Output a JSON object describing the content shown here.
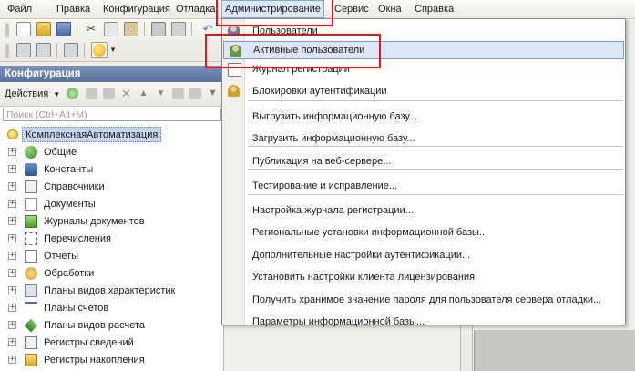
{
  "menubar": {
    "items": [
      {
        "label": "Файл"
      },
      {
        "label": "Правка"
      },
      {
        "label": "Конфигурация"
      },
      {
        "label": "Отладка"
      },
      {
        "label": "Администрирование"
      },
      {
        "label": "Сервис"
      },
      {
        "label": "Окна"
      },
      {
        "label": "Справка"
      }
    ]
  },
  "panel": {
    "title": "Конфигурация",
    "actions_label": "Действия",
    "search_placeholder": "Поиск (Ctrl+Alt+M)",
    "root_label": "КомплекснаяАвтоматизация",
    "tree_items": [
      {
        "label": "Общие",
        "icon": "common-objects-icon"
      },
      {
        "label": "Константы",
        "icon": "constants-icon"
      },
      {
        "label": "Справочники",
        "icon": "catalogs-icon"
      },
      {
        "label": "Документы",
        "icon": "documents-icon"
      },
      {
        "label": "Журналы документов",
        "icon": "document-journals-icon"
      },
      {
        "label": "Перечисления",
        "icon": "enums-icon"
      },
      {
        "label": "Отчеты",
        "icon": "reports-icon"
      },
      {
        "label": "Обработки",
        "icon": "data-processors-icon"
      },
      {
        "label": "Планы видов характеристик",
        "icon": "chart-of-characteristic-types-icon"
      },
      {
        "label": "Планы счетов",
        "icon": "chart-of-accounts-icon"
      },
      {
        "label": "Планы видов расчета",
        "icon": "chart-of-calculation-types-icon"
      },
      {
        "label": "Регистры сведений",
        "icon": "information-registers-icon"
      },
      {
        "label": "Регистры накопления",
        "icon": "accumulation-registers-icon"
      }
    ]
  },
  "dropdown": {
    "items": [
      {
        "label": "Пользователи",
        "icon": "users-icon"
      },
      {
        "label": "Активные пользователи",
        "icon": "active-users-icon",
        "highlighted": true
      },
      {
        "label": "Журнал регистрации",
        "icon": "event-log-icon"
      },
      {
        "label": "Блокировки аутентификации",
        "icon": "auth-lock-icon"
      },
      {
        "label": "Выгрузить информационную базу..."
      },
      {
        "label": "Загрузить информационную базу..."
      },
      {
        "label": "Публикация на веб-сервере..."
      },
      {
        "label": "Тестирование и исправление..."
      },
      {
        "label": "Настройка журнала регистрации..."
      },
      {
        "label": "Региональные установки информационной базы..."
      },
      {
        "label": "Дополнительные настройки аутентификации..."
      },
      {
        "label": "Установить настройки клиента лицензирования"
      },
      {
        "label": "Получить хранимое значение пароля для пользователя сервера отладки..."
      },
      {
        "label": "Параметры информационной базы..."
      }
    ]
  },
  "colors": {
    "highlight_fill": "#dce6f6",
    "highlight_border": "#7c98c6",
    "annotation_red": "#e8141c",
    "panel_title_bg": "#6a82aa"
  }
}
